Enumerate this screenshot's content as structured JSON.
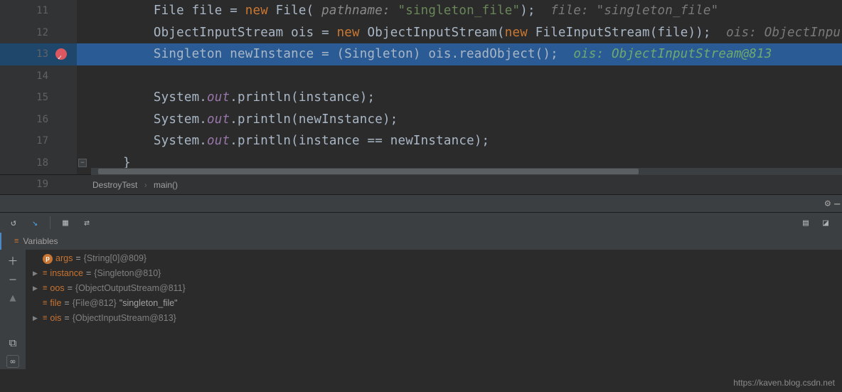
{
  "lines": [
    {
      "num": "11"
    },
    {
      "num": "12"
    },
    {
      "num": "13"
    },
    {
      "num": "14"
    },
    {
      "num": "15"
    },
    {
      "num": "16"
    },
    {
      "num": "17"
    },
    {
      "num": "18"
    },
    {
      "num": "19"
    }
  ],
  "code": {
    "l11_pre": "        File file = ",
    "l11_new": "new",
    "l11_mid": " File(",
    "l11_param": " pathname: ",
    "l11_str": "\"singleton_file\"",
    "l11_post": ");  ",
    "l11_hint": "file: \"singleton_file\"",
    "l12_pre": "        ObjectInputStream ois = ",
    "l12_new1": "new",
    "l12_mid1": " ObjectInputStream(",
    "l12_new2": "new",
    "l12_mid2": " FileInputStream(file));  ",
    "l12_hint": "ois: ObjectInputS",
    "l13_pre": "        Singleton newInstance = (Singleton) ois.readObject();  ",
    "l13_hint": "ois: ObjectInputStream@813",
    "l14": "",
    "l15_pre": "        System.",
    "l15_out": "out",
    "l15_post": ".println(instance);",
    "l16_pre": "        System.",
    "l16_out": "out",
    "l16_post": ".println(newInstance);",
    "l17_pre": "        System.",
    "l17_out": "out",
    "l17_post": ".println(instance == newInstance);",
    "l18": "    }",
    "l19": "}"
  },
  "breadcrumb": {
    "class": "DestroyTest",
    "method": "main()"
  },
  "variables_panel": {
    "title": "Variables"
  },
  "vars": {
    "args_name": "args",
    "args_val": "{String[0]@809}",
    "instance_name": "instance",
    "instance_val": "{Singleton@810}",
    "oos_name": "oos",
    "oos_val": "{ObjectOutputStream@811}",
    "file_name": "file",
    "file_val": "{File@812}",
    "file_str": " \"singleton_file\"",
    "ois_name": "ois",
    "ois_val": "{ObjectInputStream@813}"
  },
  "watermark": "https://kaven.blog.csdn.net",
  "glyphs": {
    "eq": " = ",
    "sep": "›",
    "gear": "⚙",
    "minus": "−",
    "plus": "＋",
    "dash": "—",
    "up": "▲",
    "copy": "⧉",
    "inf": "∞",
    "arrow": "▶",
    "menu": "≡",
    "restart": "↺",
    "stepblue": "↘",
    "table": "▦",
    "code": "⇄",
    "thread1": "▤",
    "thread2": "◪",
    "foldminus": "−"
  }
}
